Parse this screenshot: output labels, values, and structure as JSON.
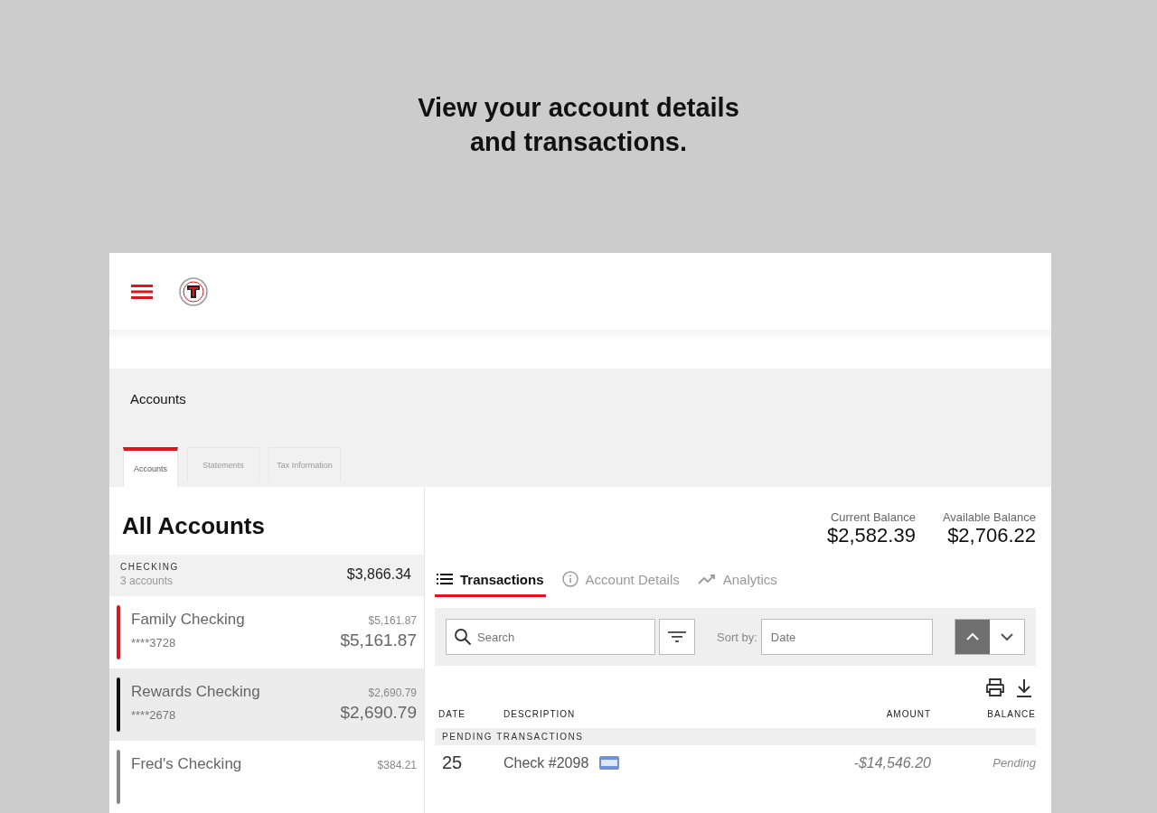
{
  "headline": [
    "View your account details",
    "and transactions."
  ],
  "page_title": "Accounts",
  "page_tabs": [
    {
      "label": "Accounts",
      "selected": true
    },
    {
      "label": "Statements",
      "selected": false
    },
    {
      "label": "Tax Information",
      "selected": false
    }
  ],
  "sidebar": {
    "title": "All Accounts",
    "group": {
      "label": "CHECKING",
      "count": "3 accounts",
      "total": "$3,866.34"
    },
    "accounts": [
      {
        "name": "Family Checking",
        "number": "****3728",
        "small_amount": "$5,161.87",
        "amount": "$5,161.87",
        "color": "#e0151b",
        "selected": false
      },
      {
        "name": "Rewards Checking",
        "number": "****2678",
        "small_amount": "$2,690.79",
        "amount": "$2,690.79",
        "color": "#111111",
        "selected": true
      },
      {
        "name": "Fred's Checking",
        "small_amount": "$384.21",
        "color": "#888888",
        "selected": false
      }
    ]
  },
  "balances": [
    {
      "label": "Current Balance",
      "value": "$2,582.39"
    },
    {
      "label": "Available Balance",
      "value": "$2,706.22"
    }
  ],
  "detail_tabs": [
    {
      "label": "Transactions",
      "kind": "list",
      "selected": true
    },
    {
      "label": "Account Details",
      "kind": "info",
      "selected": false
    },
    {
      "label": "Analytics",
      "kind": "trend",
      "selected": false
    }
  ],
  "toolbar": {
    "search_placeholder": "Search",
    "sort_label": "Sort by:",
    "sort_placeholder": "Date",
    "ascending": true
  },
  "table": {
    "columns": [
      "DATE",
      "DESCRIPTION",
      "AMOUNT",
      "BALANCE"
    ],
    "section": "PENDING TRANSACTIONS",
    "rows": [
      {
        "day": "25",
        "description": "Check #2098",
        "amount": "-$14,546.20",
        "balance": "Pending"
      }
    ]
  }
}
